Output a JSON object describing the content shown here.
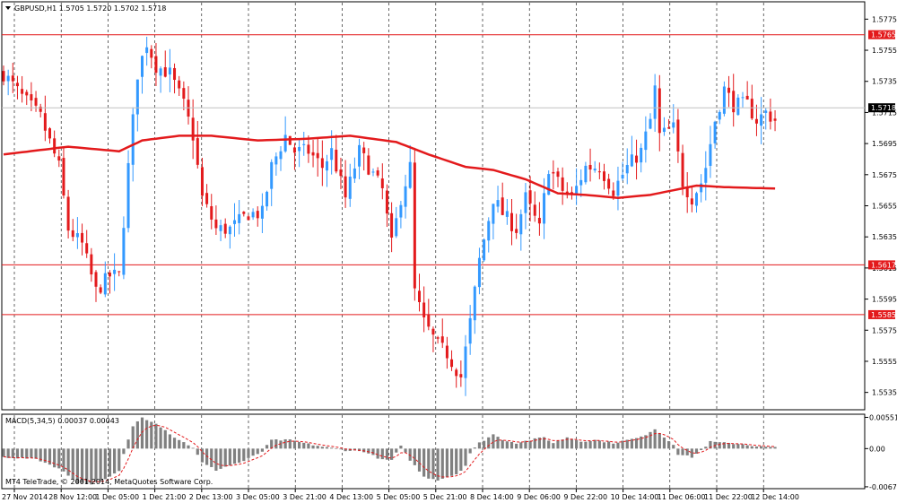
{
  "symbol_header": "GBPUSD,H1  1.5705 1.5720 1.5702 1.5718",
  "macd_header": "MACD(5,34,5) 0.00037 0.00043",
  "copyright": "MT4 TeleTrade, © 2001-2014, MetaQuotes Software Corp.",
  "colors": {
    "background": "#ffffff",
    "bull_candle": "#3399ff",
    "bear_candle": "#e31a1c",
    "moving_average": "#e31a1c",
    "level_line": "#e31a1c",
    "histogram": "#808080",
    "signal_line": "#e31a1c",
    "grid": "#000000"
  },
  "chart_data": [
    {
      "type": "candlestick",
      "title": "GBPUSD,H1",
      "ylim": [
        1.5525,
        1.5785
      ],
      "y_ticks": [
        "1.5775",
        "1.5755",
        "1.5735",
        "1.5715",
        "1.5695",
        "1.5675",
        "1.5655",
        "1.5635",
        "1.5615",
        "1.5595",
        "1.5575",
        "1.5555",
        "1.5535"
      ],
      "current_price": "1.5718",
      "levels": [
        {
          "value": 1.5765,
          "label": "1.5765"
        },
        {
          "value": 1.5617,
          "label": "1.5617"
        },
        {
          "value": 1.5585,
          "label": "1.5585"
        }
      ],
      "x_labels": [
        "27 Nov 2014",
        "28 Nov 12:00",
        "1 Dec 05:00",
        "1 Dec 21:00",
        "2 Dec 13:00",
        "3 Dec 05:00",
        "3 Dec 21:00",
        "4 Dec 13:00",
        "5 Dec 05:00",
        "5 Dec 21:00",
        "8 Dec 14:00",
        "9 Dec 06:00",
        "9 Dec 22:00",
        "10 Dec 14:00",
        "11 Dec 06:00",
        "11 Dec 22:00",
        "12 Dec 14:00"
      ],
      "close_anchors": [
        [
          0,
          1.574
        ],
        [
          4,
          1.5725
        ],
        [
          8,
          1.5712
        ],
        [
          12,
          1.568
        ],
        [
          14,
          1.564
        ],
        [
          17,
          1.563
        ],
        [
          20,
          1.56
        ],
        [
          23,
          1.561
        ],
        [
          25,
          1.561
        ],
        [
          27,
          1.568
        ],
        [
          29,
          1.574
        ],
        [
          31,
          1.576
        ],
        [
          33,
          1.5745
        ],
        [
          36,
          1.574
        ],
        [
          39,
          1.572
        ],
        [
          41,
          1.57
        ],
        [
          43,
          1.566
        ],
        [
          46,
          1.564
        ],
        [
          49,
          1.564
        ],
        [
          53,
          1.565
        ],
        [
          56,
          1.565
        ],
        [
          58,
          1.568
        ],
        [
          61,
          1.57
        ],
        [
          63,
          1.569
        ],
        [
          66,
          1.569
        ],
        [
          69,
          1.568
        ],
        [
          71,
          1.569
        ],
        [
          74,
          1.566
        ],
        [
          77,
          1.569
        ],
        [
          79,
          1.568
        ],
        [
          82,
          1.5665
        ],
        [
          84,
          1.563
        ],
        [
          86,
          1.566
        ],
        [
          88,
          1.568
        ],
        [
          89,
          1.56
        ],
        [
          91,
          1.558
        ],
        [
          94,
          1.5565
        ],
        [
          96,
          1.556
        ],
        [
          98,
          1.555
        ],
        [
          99,
          1.5545
        ],
        [
          101,
          1.558
        ],
        [
          103,
          1.562
        ],
        [
          106,
          1.566
        ],
        [
          108,
          1.565
        ],
        [
          111,
          1.564
        ],
        [
          113,
          1.566
        ],
        [
          116,
          1.564
        ],
        [
          118,
          1.568
        ],
        [
          121,
          1.5665
        ],
        [
          123,
          1.566
        ],
        [
          126,
          1.568
        ],
        [
          129,
          1.568
        ],
        [
          132,
          1.5665
        ],
        [
          135,
          1.568
        ],
        [
          138,
          1.569
        ],
        [
          140,
          1.571
        ],
        [
          141,
          1.573
        ],
        [
          142,
          1.57
        ],
        [
          145,
          1.5705
        ],
        [
          147,
          1.567
        ],
        [
          149,
          1.566
        ],
        [
          151,
          1.567
        ],
        [
          152,
          1.568
        ],
        [
          154,
          1.571
        ],
        [
          156,
          1.573
        ],
        [
          158,
          1.572
        ],
        [
          161,
          1.572
        ],
        [
          163,
          1.571
        ],
        [
          165,
          1.5715
        ],
        [
          167,
          1.571
        ]
      ],
      "moving_average": [
        [
          0,
          1.5688
        ],
        [
          14,
          1.5693
        ],
        [
          25,
          1.569
        ],
        [
          30,
          1.5697
        ],
        [
          38,
          1.57
        ],
        [
          45,
          1.57
        ],
        [
          55,
          1.5697
        ],
        [
          65,
          1.5698
        ],
        [
          75,
          1.57
        ],
        [
          85,
          1.5696
        ],
        [
          92,
          1.5688
        ],
        [
          100,
          1.568
        ],
        [
          106,
          1.5678
        ],
        [
          113,
          1.5672
        ],
        [
          120,
          1.5663
        ],
        [
          126,
          1.5662
        ],
        [
          133,
          1.566
        ],
        [
          140,
          1.5662
        ],
        [
          145,
          1.5665
        ],
        [
          150,
          1.5668
        ],
        [
          156,
          1.5667
        ],
        [
          168,
          1.5666
        ]
      ]
    },
    {
      "type": "bar",
      "title": "MACD(5,34,5)",
      "ylim": [
        -0.0069,
        0.0059
      ],
      "y_ticks": [
        "0.00551",
        "0.00",
        "-0.00673"
      ],
      "macd_anchors": [
        [
          0,
          -0.0015
        ],
        [
          7,
          -0.0018
        ],
        [
          12,
          -0.0035
        ],
        [
          16,
          -0.006
        ],
        [
          19,
          -0.0062
        ],
        [
          22,
          -0.0055
        ],
        [
          25,
          -0.004
        ],
        [
          26,
          -0.001
        ],
        [
          28,
          0.004
        ],
        [
          30,
          0.0055
        ],
        [
          33,
          0.0045
        ],
        [
          37,
          0.002
        ],
        [
          41,
          0.0002
        ],
        [
          43,
          -0.0025
        ],
        [
          46,
          -0.0038
        ],
        [
          48,
          -0.0032
        ],
        [
          52,
          -0.0022
        ],
        [
          56,
          -0.0005
        ],
        [
          58,
          0.0015
        ],
        [
          62,
          0.0015
        ],
        [
          66,
          0.0008
        ],
        [
          70,
          0.0002
        ],
        [
          74,
          -0.0003
        ],
        [
          78,
          -0.0005
        ],
        [
          82,
          -0.002
        ],
        [
          84,
          -0.002
        ],
        [
          86,
          0.0004
        ],
        [
          88,
          -0.002
        ],
        [
          91,
          -0.005
        ],
        [
          94,
          -0.0055
        ],
        [
          98,
          -0.0045
        ],
        [
          100,
          -0.003
        ],
        [
          101,
          -0.0008
        ],
        [
          103,
          0.001
        ],
        [
          106,
          0.0025
        ],
        [
          108,
          0.0016
        ],
        [
          111,
          0.001
        ],
        [
          114,
          0.0015
        ],
        [
          117,
          0.002
        ],
        [
          119,
          0.001
        ],
        [
          122,
          0.002
        ],
        [
          125,
          0.0013
        ],
        [
          128,
          0.0015
        ],
        [
          132,
          0.001
        ],
        [
          135,
          0.0015
        ],
        [
          138,
          0.002
        ],
        [
          141,
          0.0035
        ],
        [
          143,
          0.002
        ],
        [
          145,
          0.0008
        ],
        [
          146,
          -0.001
        ],
        [
          149,
          -0.0015
        ],
        [
          151,
          -0.0003
        ],
        [
          153,
          0.0012
        ],
        [
          156,
          0.001
        ],
        [
          160,
          0.0008
        ],
        [
          163,
          0.0004
        ],
        [
          165,
          0.0003
        ],
        [
          167,
          0.0002
        ]
      ]
    }
  ]
}
